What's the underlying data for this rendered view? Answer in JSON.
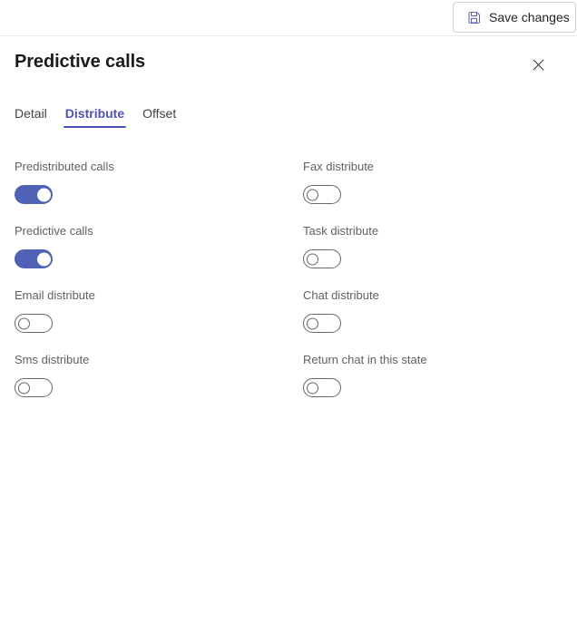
{
  "commandbar": {
    "save_label": "Save changes",
    "save_icon": "save-floppy-icon"
  },
  "panel": {
    "title": "Predictive calls",
    "close_icon": "close-x-icon",
    "accent_color": "#4f52b2",
    "toggle_on_color": "#4f62b5",
    "tabs": [
      {
        "label": "Detail",
        "active": false
      },
      {
        "label": "Distribute",
        "active": true
      },
      {
        "label": "Offset",
        "active": false
      }
    ],
    "fields": [
      {
        "label": "Predistributed calls",
        "state": "on"
      },
      {
        "label": "Fax distribute",
        "state": "off"
      },
      {
        "label": "Predictive calls",
        "state": "on"
      },
      {
        "label": "Task distribute",
        "state": "off"
      },
      {
        "label": "Email distribute",
        "state": "off"
      },
      {
        "label": "Chat distribute",
        "state": "off"
      },
      {
        "label": "Sms distribute",
        "state": "off"
      },
      {
        "label": "Return chat in this state",
        "state": "off"
      }
    ]
  }
}
